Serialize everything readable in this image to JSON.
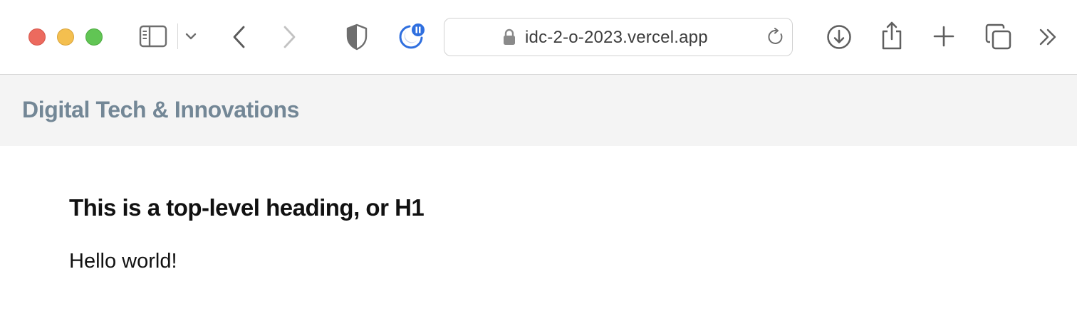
{
  "browser": {
    "url": "idc-2-o-2023.vercel.app",
    "icons": {
      "sidebar": "sidebar-icon",
      "sidebar_menu": "chevron-down-icon",
      "back": "chevron-left-icon",
      "forward": "chevron-right-icon",
      "privacy": "shield-icon",
      "extension": "extension-pause-icon",
      "lock": "lock-icon",
      "reload": "reload-icon",
      "downloads": "download-icon",
      "share": "share-icon",
      "new_tab": "plus-icon",
      "tab_overview": "tabs-icon",
      "more": "double-chevron-right-icon"
    },
    "traffic_colors": {
      "close": "#ec6a5e",
      "minimize": "#f4bf4f",
      "maximize": "#61c554"
    }
  },
  "site": {
    "brand": "Digital Tech & Innovations",
    "brand_color": "#738796",
    "header_bg": "#f4f4f4"
  },
  "main": {
    "heading": "This is a top-level heading, or H1",
    "paragraph": "Hello world!"
  }
}
